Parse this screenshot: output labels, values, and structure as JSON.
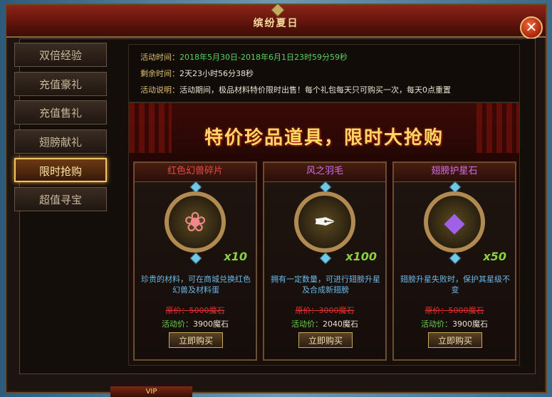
{
  "window": {
    "title": "缤纷夏日",
    "close_label": "✕"
  },
  "sidebar": {
    "items": [
      {
        "label": "双倍经验",
        "active": false
      },
      {
        "label": "充值豪礼",
        "active": false
      },
      {
        "label": "充值售礼",
        "active": false
      },
      {
        "label": "翅膀献礼",
        "active": false
      },
      {
        "label": "限时抢购",
        "active": true
      },
      {
        "label": "超值寻宝",
        "active": false
      }
    ]
  },
  "info": {
    "time_label": "活动时间：",
    "time_value": "2018年5月30日-2018年6月1日23时59分59秒",
    "remain_label": "剩余时间：",
    "remain_value": "2天23小时56分38秒",
    "desc_label": "活动说明：",
    "desc_value": "活动期间，极品材料特价限时出售！每个礼包每天只可购买一次，每天0点重置"
  },
  "banner": "特价珍品道具，限时大抢购",
  "cards": [
    {
      "name": "红色幻兽碎片",
      "name_color": "#e84848",
      "icon": "lotus-icon",
      "glyph": "❀",
      "glyph_color": "#f08a8a",
      "qty": "x10",
      "desc": "珍贵的材料，可在商城兑换红色幻兽及材料蛋",
      "orig_price": "原价：5000魔石",
      "sale_label": "活动价：",
      "sale_value": "3900魔石",
      "buy_label": "立即购买"
    },
    {
      "name": "风之羽毛",
      "name_color": "#d070e8",
      "icon": "feather-icon",
      "glyph": "✒",
      "glyph_color": "#f4f4f4",
      "qty": "x100",
      "desc": "拥有一定数量，可进行翅膀升星及合成新翅膀",
      "orig_price": "原价：3000魔石",
      "sale_label": "活动价：",
      "sale_value": "2040魔石",
      "buy_label": "立即购买"
    },
    {
      "name": "翅膀护星石",
      "name_color": "#d070e8",
      "icon": "purple-gem-icon",
      "glyph": "◆",
      "glyph_color": "#a060e8",
      "qty": "x50",
      "desc": "翅膀升星失败时，保护其星级不变",
      "orig_price": "原价：5000魔石",
      "sale_label": "活动价：",
      "sale_value": "3900魔石",
      "buy_label": "立即购买"
    }
  ],
  "footer": {
    "vip_text": "VIP"
  }
}
